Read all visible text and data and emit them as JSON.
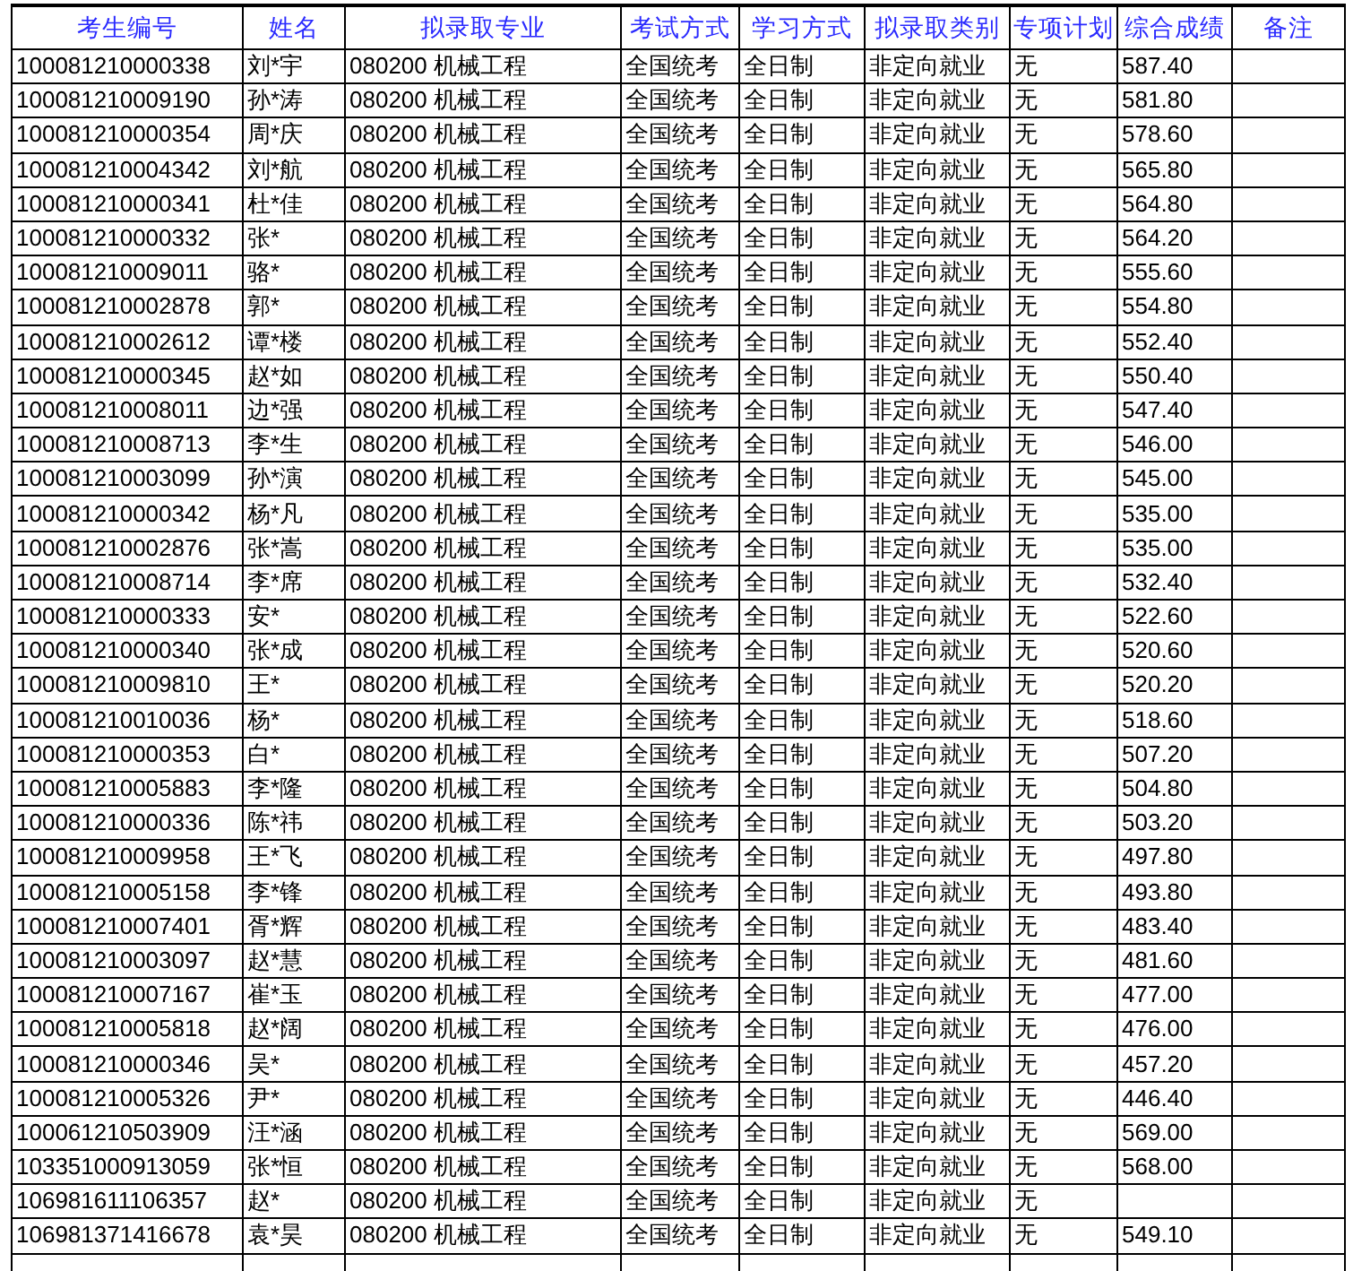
{
  "table": {
    "columns": [
      "考生编号",
      "姓名",
      "拟录取专业",
      "考试方式",
      "学习方式",
      "拟录取类别",
      "专项计划",
      "综合成绩",
      "备注"
    ],
    "rows": [
      [
        "100081210000338",
        "刘*宇",
        "080200 机械工程",
        "全国统考",
        "全日制",
        "非定向就业",
        "无",
        "587.40"
      ],
      [
        "100081210009190",
        "孙*涛",
        "080200 机械工程",
        "全国统考",
        "全日制",
        "非定向就业",
        "无",
        "581.80"
      ],
      [
        "100081210000354",
        "周*庆",
        "080200 机械工程",
        "全国统考",
        "全日制",
        "非定向就业",
        "无",
        "578.60"
      ],
      [
        "100081210004342",
        "刘*航",
        "080200 机械工程",
        "全国统考",
        "全日制",
        "非定向就业",
        "无",
        "565.80"
      ],
      [
        "100081210000341",
        "杜*佳",
        "080200 机械工程",
        "全国统考",
        "全日制",
        "非定向就业",
        "无",
        "564.80"
      ],
      [
        "100081210000332",
        "张*",
        "080200 机械工程",
        "全国统考",
        "全日制",
        "非定向就业",
        "无",
        "564.20"
      ],
      [
        "100081210009011",
        "骆*",
        "080200 机械工程",
        "全国统考",
        "全日制",
        "非定向就业",
        "无",
        "555.60"
      ],
      [
        "100081210002878",
        "郭*",
        "080200 机械工程",
        "全国统考",
        "全日制",
        "非定向就业",
        "无",
        "554.80"
      ],
      [
        "100081210002612",
        "谭*楼",
        "080200 机械工程",
        "全国统考",
        "全日制",
        "非定向就业",
        "无",
        "552.40"
      ],
      [
        "100081210000345",
        "赵*如",
        "080200 机械工程",
        "全国统考",
        "全日制",
        "非定向就业",
        "无",
        "550.40"
      ],
      [
        "100081210008011",
        "边*强",
        "080200 机械工程",
        "全国统考",
        "全日制",
        "非定向就业",
        "无",
        "547.40"
      ],
      [
        "100081210008713",
        "李*生",
        "080200 机械工程",
        "全国统考",
        "全日制",
        "非定向就业",
        "无",
        "546.00"
      ],
      [
        "100081210003099",
        "孙*演",
        "080200 机械工程",
        "全国统考",
        "全日制",
        "非定向就业",
        "无",
        "545.00"
      ],
      [
        "100081210000342",
        "杨*凡",
        "080200 机械工程",
        "全国统考",
        "全日制",
        "非定向就业",
        "无",
        "535.00"
      ],
      [
        "100081210002876",
        "张*嵩",
        "080200 机械工程",
        "全国统考",
        "全日制",
        "非定向就业",
        "无",
        "535.00"
      ],
      [
        "100081210008714",
        "李*席",
        "080200 机械工程",
        "全国统考",
        "全日制",
        "非定向就业",
        "无",
        "532.40"
      ],
      [
        "100081210000333",
        "安*",
        "080200 机械工程",
        "全国统考",
        "全日制",
        "非定向就业",
        "无",
        "522.60"
      ],
      [
        "100081210000340",
        "张*成",
        "080200 机械工程",
        "全国统考",
        "全日制",
        "非定向就业",
        "无",
        "520.60"
      ],
      [
        "100081210009810",
        "王*",
        "080200 机械工程",
        "全国统考",
        "全日制",
        "非定向就业",
        "无",
        "520.20"
      ],
      [
        "100081210010036",
        "杨*",
        "080200 机械工程",
        "全国统考",
        "全日制",
        "非定向就业",
        "无",
        "518.60"
      ],
      [
        "100081210000353",
        "白*",
        "080200 机械工程",
        "全国统考",
        "全日制",
        "非定向就业",
        "无",
        "507.20"
      ],
      [
        "100081210005883",
        "李*隆",
        "080200 机械工程",
        "全国统考",
        "全日制",
        "非定向就业",
        "无",
        "504.80"
      ],
      [
        "100081210000336",
        "陈*祎",
        "080200 机械工程",
        "全国统考",
        "全日制",
        "非定向就业",
        "无",
        "503.20"
      ],
      [
        "100081210009958",
        "王*飞",
        "080200 机械工程",
        "全国统考",
        "全日制",
        "非定向就业",
        "无",
        "497.80"
      ],
      [
        "100081210005158",
        "李*锋",
        "080200 机械工程",
        "全国统考",
        "全日制",
        "非定向就业",
        "无",
        "493.80"
      ],
      [
        "100081210007401",
        "胥*辉",
        "080200 机械工程",
        "全国统考",
        "全日制",
        "非定向就业",
        "无",
        "483.40"
      ],
      [
        "100081210003097",
        "赵*慧",
        "080200 机械工程",
        "全国统考",
        "全日制",
        "非定向就业",
        "无",
        "481.60"
      ],
      [
        "100081210007167",
        "崔*玉",
        "080200 机械工程",
        "全国统考",
        "全日制",
        "非定向就业",
        "无",
        "477.00"
      ],
      [
        "100081210005818",
        "赵*阔",
        "080200 机械工程",
        "全国统考",
        "全日制",
        "非定向就业",
        "无",
        "476.00"
      ],
      [
        "100081210000346",
        "吴*",
        "080200 机械工程",
        "全国统考",
        "全日制",
        "非定向就业",
        "无",
        "457.20"
      ],
      [
        "100081210005326",
        "尹*",
        "080200 机械工程",
        "全国统考",
        "全日制",
        "非定向就业",
        "无",
        "446.40"
      ],
      [
        "100061210503909",
        "汪*涵",
        "080200 机械工程",
        "全国统考",
        "全日制",
        "非定向就业",
        "无",
        "569.00"
      ],
      [
        "103351000913059",
        "张*恒",
        "080200 机械工程",
        "全国统考",
        "全日制",
        "非定向就业",
        "无",
        "568.00"
      ],
      [
        "106981611106357",
        "赵*",
        "080200 机械工程",
        "全国统考",
        "全日制",
        "非定向就业",
        "无"
      ],
      [
        "106981371416678",
        "袁*昊",
        "080200 机械工程",
        "全国统考",
        "全日制",
        "非定向就业",
        "无",
        "549.10"
      ]
    ]
  }
}
